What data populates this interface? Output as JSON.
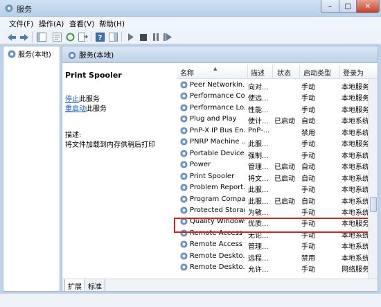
{
  "window": {
    "title": "服务"
  },
  "window_controls": {
    "minimize": "–",
    "maximize": "□",
    "close": "✕"
  },
  "menu": [
    "文件(F)",
    "操作(A)",
    "查看(V)",
    "帮助(H)"
  ],
  "tree": {
    "root": "服务(本地)"
  },
  "pane_header": "服务(本地)",
  "selected_service": {
    "name": "Print Spooler",
    "stop_link": "停止",
    "stop_suffix": "此服务",
    "restart_link": "重启动",
    "restart_suffix": "此服务",
    "desc_label": "描述:",
    "desc_text": "将文件加载到内存供稍后打印"
  },
  "columns": [
    "名称",
    "描述",
    "状态",
    "启动类型",
    "登录为"
  ],
  "rows": [
    {
      "name": "Peer Networkin...",
      "desc": "向对...",
      "status": "",
      "startup": "手动",
      "logon": "本地服务"
    },
    {
      "name": "Performance Co...",
      "desc": "使远...",
      "status": "",
      "startup": "手动",
      "logon": "本地服务"
    },
    {
      "name": "Performance Lo...",
      "desc": "性能...",
      "status": "",
      "startup": "手动",
      "logon": "本地服务"
    },
    {
      "name": "Plug and Play",
      "desc": "使计...",
      "status": "已启动",
      "startup": "自动",
      "logon": "本地系统"
    },
    {
      "name": "PnP-X IP Bus En...",
      "desc": "PnP-...",
      "status": "",
      "startup": "禁用",
      "logon": "本地系统"
    },
    {
      "name": "PNRP Machine ...",
      "desc": "此服...",
      "status": "",
      "startup": "手动",
      "logon": "本地服务"
    },
    {
      "name": "Portable Device ...",
      "desc": "强制...",
      "status": "",
      "startup": "手动",
      "logon": "本地系统"
    },
    {
      "name": "Power",
      "desc": "管理...",
      "status": "已启动",
      "startup": "自动",
      "logon": "本地系统"
    },
    {
      "name": "Print Spooler",
      "desc": "将文...",
      "status": "已启动",
      "startup": "自动",
      "logon": "本地系统"
    },
    {
      "name": "Problem Report...",
      "desc": "此服...",
      "status": "",
      "startup": "手动",
      "logon": "本地系统"
    },
    {
      "name": "Program Compa...",
      "desc": "此服...",
      "status": "已启动",
      "startup": "自动",
      "logon": "本地系统"
    },
    {
      "name": "Protected Storage",
      "desc": "为敏...",
      "status": "",
      "startup": "手动",
      "logon": "本地系统"
    },
    {
      "name": "Quality Windows...",
      "desc": "优质...",
      "status": "",
      "startup": "手动",
      "logon": "本地服务"
    },
    {
      "name": "Remote Access ...",
      "desc": "无论...",
      "status": "",
      "startup": "手动",
      "logon": "本地系统"
    },
    {
      "name": "Remote Access ...",
      "desc": "管理...",
      "status": "",
      "startup": "手动",
      "logon": "本地系统"
    },
    {
      "name": "Remote Deskto...",
      "desc": "远程...",
      "status": "",
      "startup": "禁用",
      "logon": "本地系统"
    },
    {
      "name": "Remote Deskto...",
      "desc": "允许...",
      "status": "",
      "startup": "手动",
      "logon": "网络服务"
    }
  ],
  "tabs": [
    "扩展",
    "标准"
  ],
  "highlight_color": "#d42020"
}
